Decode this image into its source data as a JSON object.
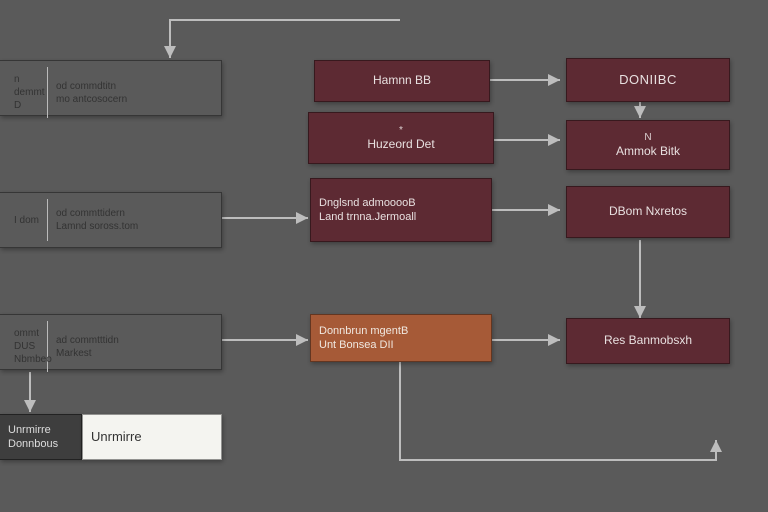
{
  "left": {
    "row1": {
      "l1": "n demmt",
      "l2": "D",
      "r1": "od commdtitn",
      "r2": "mo antcosocern"
    },
    "row2": {
      "l1": "I dom",
      "r1": "od commttidern",
      "r2": "Lamnd soross.tom"
    },
    "row3": {
      "l1": "ommt DUS",
      "l2": "Nbmbeo",
      "r1": "ad commtttidn",
      "r2": "Markest"
    },
    "row4": {
      "t1": "Unrmirre",
      "t2": "Donnbous"
    }
  },
  "mid": {
    "b1": "Hamnn BB",
    "b2": "Huzeord Det",
    "b3l1": "Dnglsnd admooooB",
    "b3l2": "Land trnna.Jermoall",
    "b4l1": "Donnbrun mgentB",
    "b4l2": "Unt Bonsea DII"
  },
  "right": {
    "b1": "DONIIBC",
    "b2t": "N",
    "b2": "Ammok Bitk",
    "b3": "DBom Nxretos",
    "b4": "Res Banmobsxh"
  },
  "colors": {
    "background": "#5a5a5a",
    "light": "#f4f4f0",
    "maroon": "#5d2a33",
    "burnt": "#a65a37",
    "grey": "#3e3e3e"
  }
}
